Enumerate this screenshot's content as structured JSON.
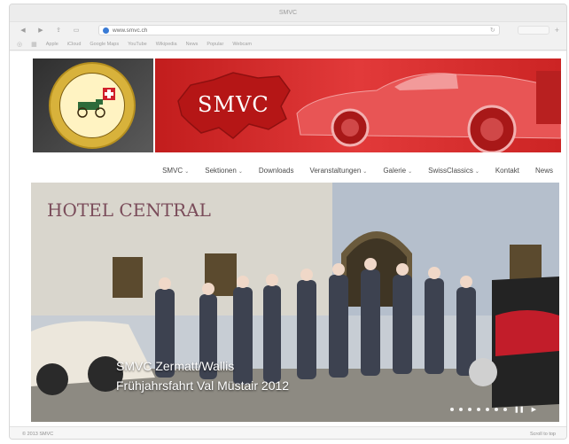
{
  "browser": {
    "title": "SMVC",
    "url": "www.smvc.ch",
    "bookmarks": [
      "Apple",
      "iCloud",
      "Google Maps",
      "YouTube",
      "Wikipedia",
      "News",
      "Popular",
      "Webcam"
    ]
  },
  "banner": {
    "title": "SMVC"
  },
  "nav": {
    "items": [
      {
        "label": "SMVC",
        "dropdown": true
      },
      {
        "label": "Sektionen",
        "dropdown": true
      },
      {
        "label": "Downloads",
        "dropdown": false
      },
      {
        "label": "Veranstaltungen",
        "dropdown": true
      },
      {
        "label": "Galerie",
        "dropdown": true
      },
      {
        "label": "SwissClassics",
        "dropdown": true
      },
      {
        "label": "Kontakt",
        "dropdown": false
      },
      {
        "label": "News",
        "dropdown": false
      }
    ]
  },
  "hero": {
    "sign": "HOTEL CENTRAL",
    "caption_line1": "SMVC Zermatt/Wallis",
    "caption_line2": "Frühjahrsfahrt Val Müstair 2012",
    "slide_count": 7
  },
  "footer": {
    "left": "© 2013 SMVC",
    "right": "Scroll to top"
  },
  "colors": {
    "banner_red": "#d42a2a",
    "emblem_gold": "#d8b23b"
  }
}
